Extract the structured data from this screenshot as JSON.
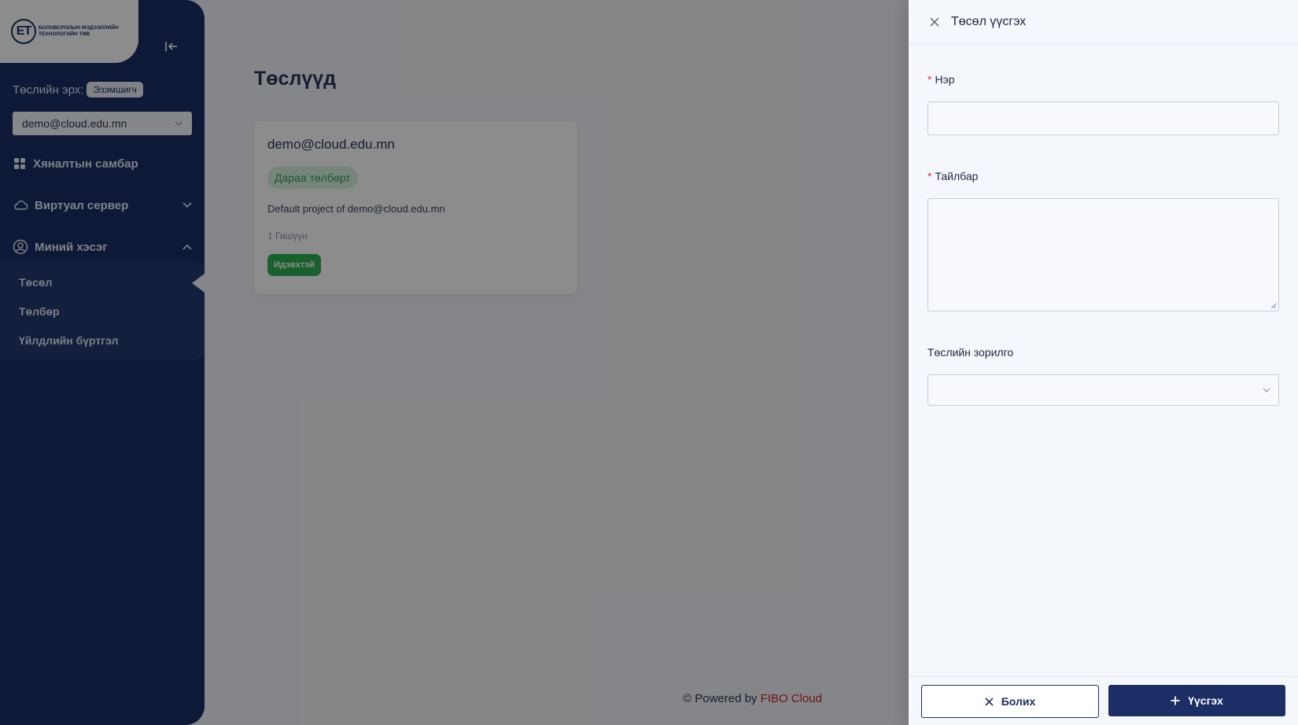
{
  "sidebar": {
    "logo": {
      "mark": "ЕТ",
      "text": "Боловсролын мэдээллийн технологийн төв"
    },
    "role_label": "Төслийн эрх:",
    "role_badge": "Эзэмшигч",
    "project_select": {
      "value": "demo@cloud.edu.mn"
    },
    "nav": {
      "dashboard": "Хяналтын самбар",
      "virtual_server": "Виртуал сервер",
      "my_section": "Миний хэсэг"
    },
    "submenu": [
      "Төсөл",
      "Төлбөр",
      "Үйлдлийн бүртгэл"
    ]
  },
  "main": {
    "title": "Төслүүд",
    "card": {
      "name": "demo@cloud.edu.mn",
      "tag": "Дараа төлбөрт",
      "description": "Default project of demo@cloud.edu.mn",
      "members": "1 Гишүүн",
      "status": "Идэвхтэй"
    },
    "footer": {
      "prefix": "© Powered by",
      "brand": "FIBO Cloud"
    }
  },
  "drawer": {
    "title": "Төсөл үүсгэх",
    "fields": {
      "name": {
        "label": "Нэр",
        "value": ""
      },
      "description": {
        "label": "Тайлбар",
        "value": ""
      },
      "purpose": {
        "label": "Төслийн зорилго",
        "value": ""
      }
    },
    "buttons": {
      "cancel": "Болих",
      "create": "Үүсгэх"
    }
  },
  "colors": {
    "primary": "#1b2f66",
    "success": "#2fb150",
    "success_light": "#d5f2dc",
    "required": "#e53935",
    "brand": "#c62828"
  }
}
